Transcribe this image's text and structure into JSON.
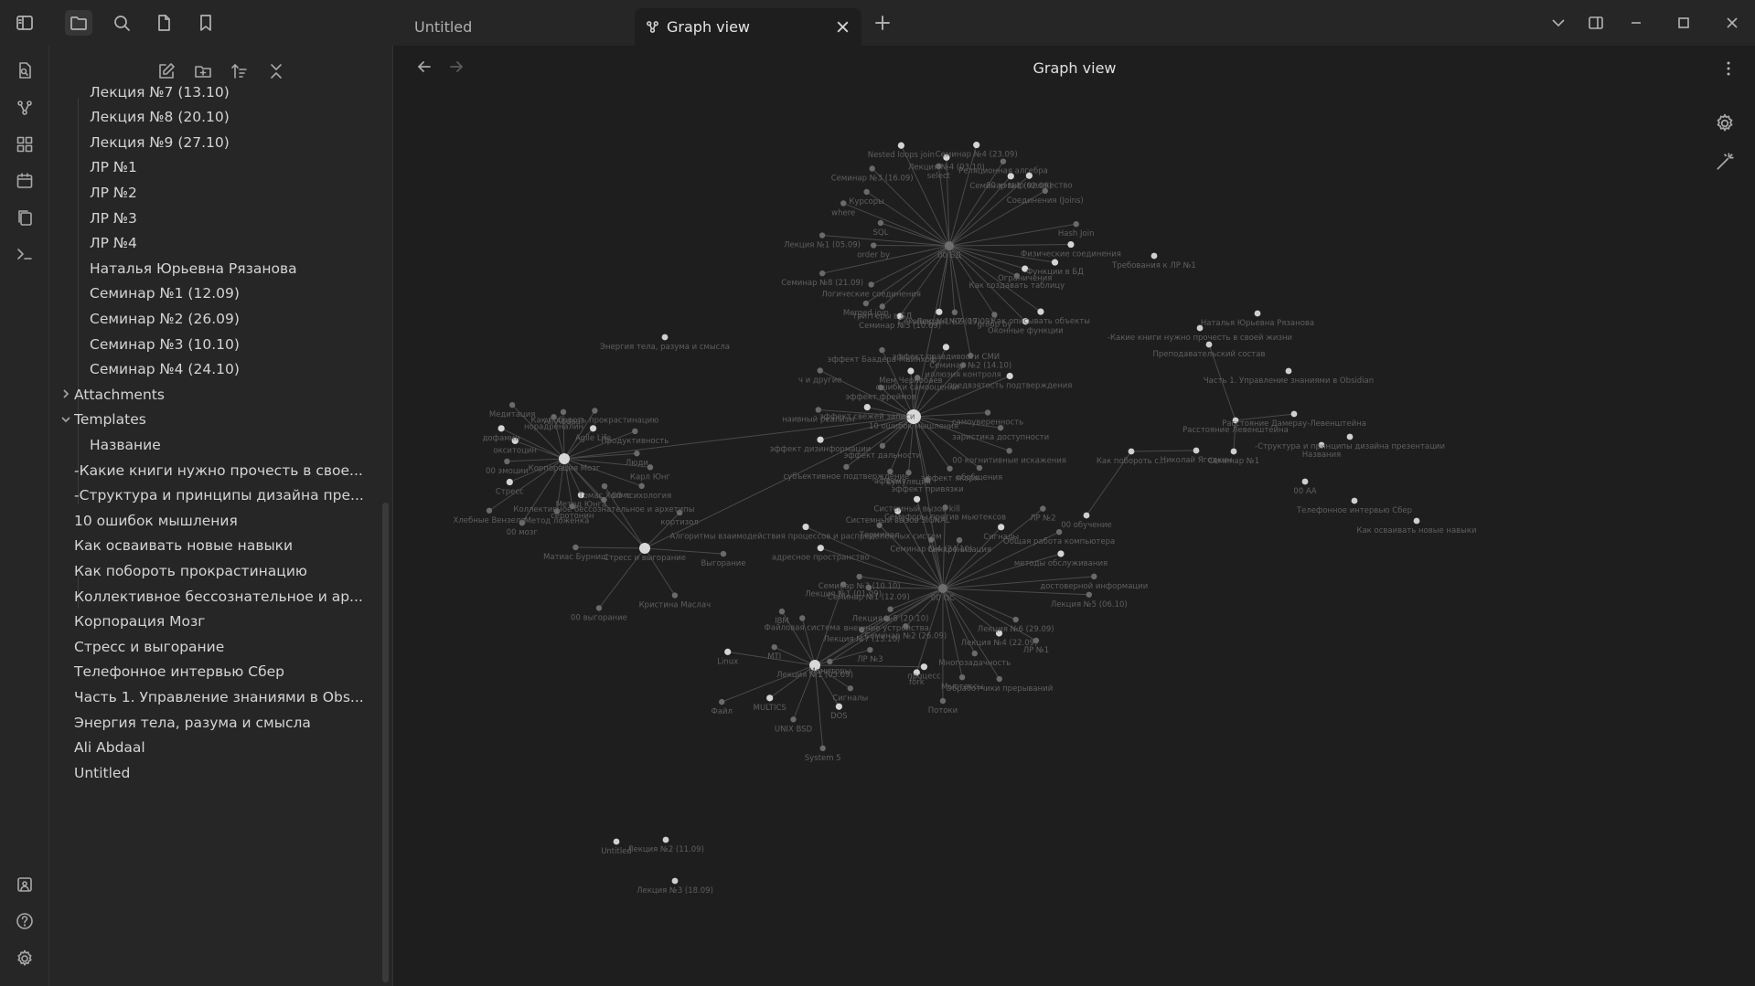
{
  "tabs": {
    "inactive_label": "Untitled",
    "active_label": "Graph view"
  },
  "view": {
    "title": "Graph view"
  },
  "explorer": {
    "items": [
      {
        "label": "Лекция №7 (13.10)",
        "level": 2
      },
      {
        "label": "Лекция №8 (20.10)",
        "level": 2
      },
      {
        "label": "Лекция №9 (27.10)",
        "level": 2
      },
      {
        "label": "ЛР №1",
        "level": 2
      },
      {
        "label": "ЛР №2",
        "level": 2
      },
      {
        "label": "ЛР №3",
        "level": 2
      },
      {
        "label": "ЛР №4",
        "level": 2
      },
      {
        "label": "Наталья Юрьевна Рязанова",
        "level": 2
      },
      {
        "label": "Семинар №1 (12.09)",
        "level": 2
      },
      {
        "label": "Семинар №2 (26.09)",
        "level": 2
      },
      {
        "label": "Семинар №3 (10.10)",
        "level": 2
      },
      {
        "label": "Семинар №4 (24.10)",
        "level": 2
      },
      {
        "label": "Attachments",
        "level": 1,
        "folder": "collapsed"
      },
      {
        "label": "Templates",
        "level": 1,
        "folder": "expanded"
      },
      {
        "label": "Название",
        "level": 2
      },
      {
        "label": "-Какие книги нужно прочесть в свое...",
        "level": 1
      },
      {
        "label": "-Структура и принципы дизайна пре...",
        "level": 1
      },
      {
        "label": "10 ошибок мышления",
        "level": 1
      },
      {
        "label": "Как осваивать новые навыки",
        "level": 1
      },
      {
        "label": "Как побороть прокрастинацию",
        "level": 1
      },
      {
        "label": "Коллективное бессознательное и ар...",
        "level": 1
      },
      {
        "label": "Корпорация Мозг",
        "level": 1
      },
      {
        "label": "Стресс и выгорание",
        "level": 1
      },
      {
        "label": "Телефонное интервью Сбер",
        "level": 1
      },
      {
        "label": "Часть 1. Управление знаниями в Obs...",
        "level": 1
      },
      {
        "label": "Энергия тела, разума и смысла",
        "level": 1
      },
      {
        "label": "Ali Abdaal",
        "level": 1
      },
      {
        "label": "Untitled",
        "level": 1
      }
    ]
  },
  "graph": {
    "clusters": [
      {
        "hub": "00 БД",
        "labels": [
          "Функции в БД",
          "Ограничения",
          "Как создавать таблицу",
          "Как описывать объекты",
          "Оконные функции",
          "group by",
          "Семинар №2 (14.10)",
          "Лекция №2 (17.09)",
          "Семинар №1 (09.09)",
          "Семинар №3 (10.09)",
          "триггеры в БД",
          "Merged join",
          "Логические соединения",
          "Семинар №8 (21.09)",
          "order by",
          "Лекция №1 (05.09)",
          "SQL",
          "where",
          "Курсоры",
          "Семинар №3 (16.09)",
          "Nested loops join",
          "select",
          "Лекция №4 (03.10)",
          "Семинар №4 (23.09)",
          "Реляционная алгебра",
          "Семинар №1 (02.09)",
          "00 хэшир множество",
          "Соединения (Joins)",
          "Hash Join",
          "Физические соединения"
        ]
      },
      {
        "hub": "10 ошибок мышления",
        "labels": [
          "заристика доступности",
          "00 когнитивные искажения",
          "обобщения",
          "эффект якоря",
          "эффект привязки",
          "кумуляция",
          "аффект",
          "эффект дальности",
          "субъективное подтверждение",
          "эффект дизинформации",
          "наивный реализм",
          "эффект свежей записи",
          "ч и другие",
          "эффект фреймов",
          "эффект Баадера-Майнхоф",
          "Мем Чернобаев",
          "ошибки самооценки",
          "эффект правдивости СМИ",
          "иллюзия контроля",
          "предвзятость подтверждения",
          "самоуверенность"
        ]
      },
      {
        "hub": "Корпорация Мозг",
        "labels": [
          "Карл Юнг",
          "00 психология",
          "Коллективное бессознательное и архетипы",
          "Метод Юнга",
          "серотонин",
          "Метод ложенка",
          "00 мозг",
          "Хлебные Вензеля",
          "Стресс",
          "00 эмоции",
          "окситоцин",
          "дофамин",
          "Медитация",
          "норадреналин",
          "Ali Abdaal",
          "Как побороть прокрастинацию",
          "Agile Life",
          "Продуктивность",
          "Люди"
        ]
      },
      {
        "hub": "Стресс и выгорание",
        "labels": [
          "Выгорание",
          "Кристина Маслач",
          "00 выгорание",
          "Матиас Бурниш",
          "Томас Холмс",
          "кортизол"
        ]
      },
      {
        "hub": "00 ОС",
        "labels": [
          "Лекция №5 (06.10)",
          "Лекция №6 (29.09)",
          "ЛР №1",
          "Лекция №4 (22.09)",
          "Обработчики прерываний",
          "Многозадачность",
          "Мьютексы",
          "Потоки",
          "fork",
          "Семинар №2 (26.09)",
          "Мониторы",
          "Лекция №7 (13.10)",
          "Лекция №8 (20.10)",
          "Семинар №1 (12.09)",
          "Семинар №3 (10.10)",
          "адресное пространство",
          "Алгоритмы взаимодействия процессов и распределенных систем",
          "Терминал",
          "Системный вызов SIGNAL",
          "Системный вызов kill",
          "Семинар №4 (24.10)",
          "Семафоры против мьютексов",
          "Синхронизация",
          "Сигналы",
          "ЛР №2",
          "Общая работа компьютера",
          "методы обслуживания",
          "достоверной информации"
        ]
      },
      {
        "hub": "Лекция №1 (05.09)",
        "labels": [
          "процесс",
          "Сигналы",
          "DOS",
          "System 5",
          "UNIX BSD",
          "MULTICS",
          "Файл",
          "Linux",
          "MTI",
          "IBM",
          "Файловая система",
          "Лекция №1 (01.09)",
          "внешние устройства",
          "ЛР №3"
        ]
      }
    ],
    "isolated": [
      "Энергия тела, разума и смысла",
      "Требования к ЛР №1",
      "-Какие книги нужно прочесть в своей жизни",
      "Наталья Юрьевна Рязанова",
      "Преподавательский состав",
      "Часть 1. Управление знаниями в Obsidian",
      "Расстояние Дамерау-Левенштейна",
      "Расстояние Левенштейна",
      "Семинар №1",
      "Названия",
      "-Структура и принципы дизайна презентации",
      "00 АА",
      "Телефонное интервью Сбер",
      "Как побороть с...",
      "Николай Ягодкин",
      "00 обучение",
      "Как осваивать новые навыки",
      "Untitled",
      "Лекция №2 (11.09)",
      "Лекция №3 (18.09)"
    ]
  }
}
